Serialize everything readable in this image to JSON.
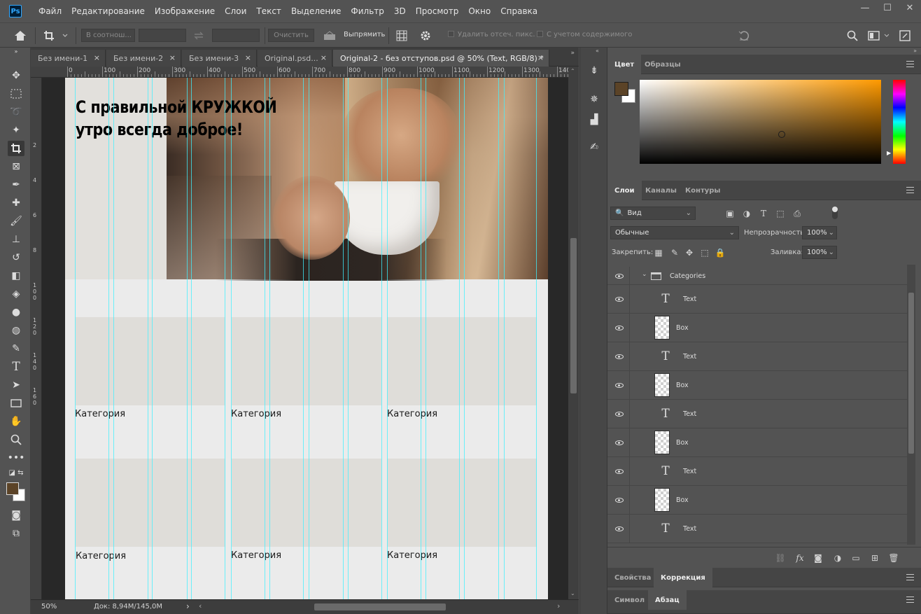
{
  "app": {
    "logo_text": "Ps"
  },
  "menu": [
    "Файл",
    "Редактирование",
    "Изображение",
    "Слои",
    "Текст",
    "Выделение",
    "Фильтр",
    "3D",
    "Просмотр",
    "Окно",
    "Справка"
  ],
  "window_controls": {
    "minimize": "—",
    "maximize": "☐",
    "close": "✕"
  },
  "options": {
    "ratio_placeholder": "В соотнош...",
    "clear_label": "Очистить",
    "straighten_label": "Выпрямить",
    "delete_cropped_label": "Удалить отсеч. пикс.",
    "content_aware_label": "С учетом содержимого"
  },
  "tabs": [
    {
      "label": "Без имени-1",
      "close": "×"
    },
    {
      "label": "Без имени-2",
      "close": "×"
    },
    {
      "label": "Без имени-3",
      "close": "×"
    },
    {
      "label": "Original.psd...",
      "close": "×"
    },
    {
      "label": "Original-2 - без отступов.psd @ 50% (Text, RGB/8) *",
      "close": "×"
    }
  ],
  "ruler": {
    "h_labels": [
      "0",
      "100",
      "200",
      "300",
      "400",
      "500",
      "600",
      "700",
      "800",
      "900",
      "1000",
      "1100",
      "1200",
      "1300",
      "140"
    ],
    "v_labels": [
      "2",
      "4",
      "6",
      "8",
      "1 0 0",
      "1 2 0",
      "1 4 0",
      "1 6 0"
    ]
  },
  "document": {
    "headline_line1": "С правильной КРУЖКОЙ",
    "headline_line2": "утро всегда доброе!",
    "categories": [
      "Категория",
      "Категория",
      "Категория",
      "Категория",
      "Категория",
      "Категория"
    ]
  },
  "status": {
    "zoom": "50%",
    "doc_info": "Док: 8,94M/145,0M",
    "arrow": "›"
  },
  "panels": {
    "color_tabs": [
      "Цвет",
      "Образцы"
    ],
    "foreground_color": "#5b4327",
    "background_color": "#ffffff",
    "picker_hue": "#ff9a00",
    "layers_tabs": [
      "Слои",
      "Каналы",
      "Контуры"
    ],
    "filter_placeholder": "Вид",
    "blend_mode": "Обычные",
    "opacity_label": "Непрозрачность:",
    "opacity_value": "100%",
    "lock_label": "Закрепить:",
    "fill_label": "Заливка:",
    "fill_value": "100%",
    "group_name": "Categories",
    "layers": [
      {
        "name": "Text",
        "type": "text"
      },
      {
        "name": "Box",
        "type": "raster"
      },
      {
        "name": "Text",
        "type": "text"
      },
      {
        "name": "Box",
        "type": "raster"
      },
      {
        "name": "Text",
        "type": "text"
      },
      {
        "name": "Box",
        "type": "raster"
      },
      {
        "name": "Text",
        "type": "text"
      },
      {
        "name": "Box",
        "type": "raster"
      },
      {
        "name": "Text",
        "type": "text"
      }
    ],
    "bottom_tabs_1": [
      "Свойства",
      "Коррекция"
    ],
    "bottom_tabs_2": [
      "Символ",
      "Абзац"
    ]
  },
  "accent_colors": {
    "guides": "#3ff0ff",
    "ps_blue": "#31a8ff"
  }
}
